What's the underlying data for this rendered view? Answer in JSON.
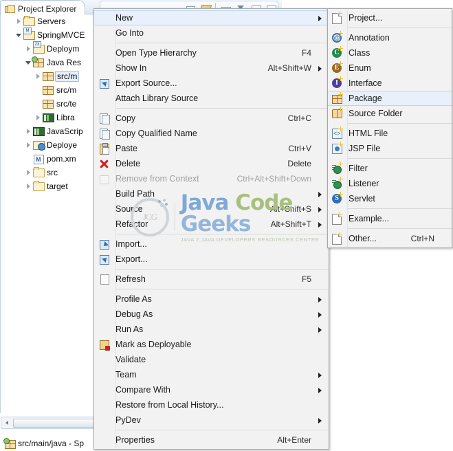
{
  "view": {
    "tab_title": "Project Explorer",
    "tab_icon": "project-explorer-icon",
    "toolbar": [
      {
        "name": "minimize-icon"
      },
      {
        "name": "link-with-editor-icon"
      },
      {
        "name": "collapse-all-icon"
      },
      {
        "name": "view-menu-icon"
      },
      {
        "name": "minimize-view-icon"
      },
      {
        "name": "maximize-view-icon"
      }
    ]
  },
  "tree": {
    "items": [
      {
        "label": "Servers",
        "indent": 1,
        "twisty": "closed",
        "icon": "folder-servers-icon",
        "selected": false
      },
      {
        "label": "SpringMVCE",
        "indent": 1,
        "twisty": "open",
        "icon": "maven-project-icon",
        "selected": false
      },
      {
        "label": "Deploym",
        "indent": 2,
        "twisty": "closed",
        "icon": "deployment-descriptor-icon",
        "selected": false
      },
      {
        "label": "Java Res",
        "indent": 2,
        "twisty": "open",
        "icon": "java-resources-icon",
        "selected": false
      },
      {
        "label": "src/m",
        "indent": 3,
        "twisty": "closed",
        "icon": "source-package-icon",
        "selected": true
      },
      {
        "label": "src/m",
        "indent": 3,
        "twisty": "none",
        "icon": "source-package-icon",
        "selected": false
      },
      {
        "label": "src/te",
        "indent": 3,
        "twisty": "none",
        "icon": "source-package-icon",
        "selected": false
      },
      {
        "label": "Libra",
        "indent": 3,
        "twisty": "closed",
        "icon": "libraries-icon",
        "selected": false
      },
      {
        "label": "JavaScrip",
        "indent": 2,
        "twisty": "closed",
        "icon": "javascript-resources-icon",
        "selected": false
      },
      {
        "label": "Deploye",
        "indent": 2,
        "twisty": "closed",
        "icon": "deployed-resources-icon",
        "selected": false
      },
      {
        "label": "pom.xm",
        "indent": 2,
        "twisty": "none",
        "icon": "maven-pom-icon",
        "selected": false
      },
      {
        "label": "src",
        "indent": 2,
        "twisty": "closed",
        "icon": "folder-icon",
        "selected": false
      },
      {
        "label": "target",
        "indent": 2,
        "twisty": "closed",
        "icon": "folder-icon",
        "selected": false
      }
    ]
  },
  "context_menu": {
    "items": [
      {
        "label": "New",
        "accel": "",
        "icon": "",
        "arrow": true,
        "highlight": true,
        "disabled": false
      },
      {
        "label": "Go Into",
        "accel": "",
        "icon": "",
        "arrow": false,
        "highlight": false,
        "disabled": false
      },
      {
        "sep": true
      },
      {
        "label": "Open Type Hierarchy",
        "accel": "F4",
        "icon": "",
        "arrow": false,
        "highlight": false,
        "disabled": false
      },
      {
        "label": "Show In",
        "accel": "Alt+Shift+W",
        "icon": "",
        "arrow": true,
        "highlight": false,
        "disabled": false
      },
      {
        "label": "Export Source...",
        "accel": "",
        "icon": "export-source-icon",
        "arrow": false,
        "highlight": false,
        "disabled": false
      },
      {
        "label": "Attach Library Source",
        "accel": "",
        "icon": "",
        "arrow": false,
        "highlight": false,
        "disabled": false
      },
      {
        "sep": true
      },
      {
        "label": "Copy",
        "accel": "Ctrl+C",
        "icon": "copy-icon",
        "arrow": false,
        "highlight": false,
        "disabled": false
      },
      {
        "label": "Copy Qualified Name",
        "accel": "",
        "icon": "copy-qualified-icon",
        "arrow": false,
        "highlight": false,
        "disabled": false
      },
      {
        "label": "Paste",
        "accel": "Ctrl+V",
        "icon": "paste-icon",
        "arrow": false,
        "highlight": false,
        "disabled": false
      },
      {
        "label": "Delete",
        "accel": "Delete",
        "icon": "delete-icon",
        "arrow": false,
        "highlight": false,
        "disabled": false
      },
      {
        "label": "Remove from Context",
        "accel": "Ctrl+Alt+Shift+Down",
        "icon": "remove-context-icon",
        "arrow": false,
        "highlight": false,
        "disabled": true
      },
      {
        "label": "Build Path",
        "accel": "",
        "icon": "",
        "arrow": true,
        "highlight": false,
        "disabled": false
      },
      {
        "label": "Source",
        "accel": "Alt+Shift+S",
        "icon": "",
        "arrow": true,
        "highlight": false,
        "disabled": false
      },
      {
        "label": "Refactor",
        "accel": "Alt+Shift+T",
        "icon": "",
        "arrow": true,
        "highlight": false,
        "disabled": false
      },
      {
        "sep": true
      },
      {
        "label": "Import...",
        "accel": "",
        "icon": "import-icon",
        "arrow": false,
        "highlight": false,
        "disabled": false
      },
      {
        "label": "Export...",
        "accel": "",
        "icon": "export-icon",
        "arrow": false,
        "highlight": false,
        "disabled": false
      },
      {
        "sep": true
      },
      {
        "label": "Refresh",
        "accel": "F5",
        "icon": "refresh-icon",
        "arrow": false,
        "highlight": false,
        "disabled": false
      },
      {
        "sep": true
      },
      {
        "label": "Profile As",
        "accel": "",
        "icon": "",
        "arrow": true,
        "highlight": false,
        "disabled": false
      },
      {
        "label": "Debug As",
        "accel": "",
        "icon": "",
        "arrow": true,
        "highlight": false,
        "disabled": false
      },
      {
        "label": "Run As",
        "accel": "",
        "icon": "",
        "arrow": true,
        "highlight": false,
        "disabled": false
      },
      {
        "label": "Mark as Deployable",
        "accel": "",
        "icon": "mark-deployable-icon",
        "arrow": false,
        "highlight": false,
        "disabled": false
      },
      {
        "label": "Validate",
        "accel": "",
        "icon": "",
        "arrow": false,
        "highlight": false,
        "disabled": false
      },
      {
        "label": "Team",
        "accel": "",
        "icon": "",
        "arrow": true,
        "highlight": false,
        "disabled": false
      },
      {
        "label": "Compare With",
        "accel": "",
        "icon": "",
        "arrow": true,
        "highlight": false,
        "disabled": false
      },
      {
        "label": "Restore from Local History...",
        "accel": "",
        "icon": "",
        "arrow": false,
        "highlight": false,
        "disabled": false
      },
      {
        "label": "PyDev",
        "accel": "",
        "icon": "",
        "arrow": true,
        "highlight": false,
        "disabled": false
      },
      {
        "sep": true
      },
      {
        "label": "Properties",
        "accel": "Alt+Enter",
        "icon": "",
        "arrow": false,
        "highlight": false,
        "disabled": false
      }
    ]
  },
  "submenu": {
    "parent": "New",
    "items": [
      {
        "label": "Project...",
        "accel": "",
        "icon": "new-project-icon",
        "highlight": false
      },
      {
        "sep": true
      },
      {
        "label": "Annotation",
        "accel": "",
        "icon": "new-annotation-icon",
        "highlight": false
      },
      {
        "label": "Class",
        "accel": "",
        "icon": "new-class-icon",
        "highlight": false
      },
      {
        "label": "Enum",
        "accel": "",
        "icon": "new-enum-icon",
        "highlight": false
      },
      {
        "label": "Interface",
        "accel": "",
        "icon": "new-interface-icon",
        "highlight": false
      },
      {
        "label": "Package",
        "accel": "",
        "icon": "new-package-icon",
        "highlight": true
      },
      {
        "label": "Source Folder",
        "accel": "",
        "icon": "new-source-folder-icon",
        "highlight": false
      },
      {
        "sep": true
      },
      {
        "label": "HTML File",
        "accel": "",
        "icon": "new-html-file-icon",
        "highlight": false
      },
      {
        "label": "JSP File",
        "accel": "",
        "icon": "new-jsp-file-icon",
        "highlight": false
      },
      {
        "sep": true
      },
      {
        "label": "Filter",
        "accel": "",
        "icon": "new-filter-icon",
        "highlight": false
      },
      {
        "label": "Listener",
        "accel": "",
        "icon": "new-listener-icon",
        "highlight": false
      },
      {
        "label": "Servlet",
        "accel": "",
        "icon": "new-servlet-icon",
        "highlight": false
      },
      {
        "sep": true
      },
      {
        "label": "Example...",
        "accel": "",
        "icon": "new-example-icon",
        "highlight": false
      },
      {
        "sep": true
      },
      {
        "label": "Other...",
        "accel": "Ctrl+N",
        "icon": "new-other-icon",
        "highlight": false
      }
    ]
  },
  "watermark": {
    "logo_text": "JCG",
    "title_1": "Java",
    "title_2": "Code",
    "title_3": "Geeks",
    "subtitle": "JAVA 2 JAVA DEVELOPERS RESOURCES CENTER"
  },
  "status_bar": {
    "icon": "source-package-icon",
    "text": "src/main/java - Sp"
  },
  "colors": {
    "menu_bg": "#f2f2f2",
    "menu_border": "#a8a8a8",
    "highlight_bg": "#e8f0fb",
    "highlight_border": "#bcd3ee",
    "tree_selection": "#e8f0fb",
    "disabled_text": "#a0a0a0",
    "status_band": "#dce6f2"
  }
}
